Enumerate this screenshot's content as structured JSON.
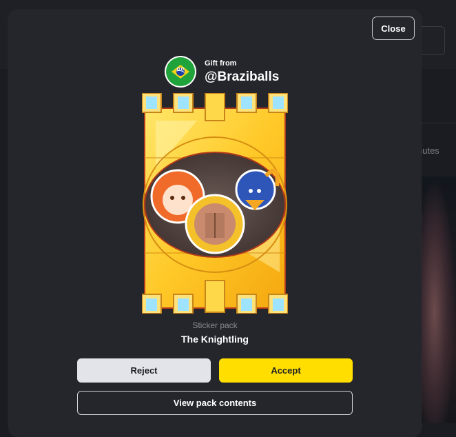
{
  "modal": {
    "close_label": "Close",
    "gift_from_label": "Gift from",
    "sender_username": "@Braziballs",
    "pack_type": "Sticker pack",
    "pack_name": "The Knightling",
    "reject_label": "Reject",
    "accept_label": "Accept",
    "view_contents_label": "View pack contents"
  },
  "background": {
    "time_fragment": "nutes"
  },
  "icons": {
    "avatar": "brazil-flag-ball-avatar",
    "pack": "knightling-sticker-pack-art"
  },
  "colors": {
    "accept": "#ffde00",
    "reject": "#e3e4ea",
    "modal_bg": "#25262c",
    "page_bg": "#1b1c21"
  }
}
